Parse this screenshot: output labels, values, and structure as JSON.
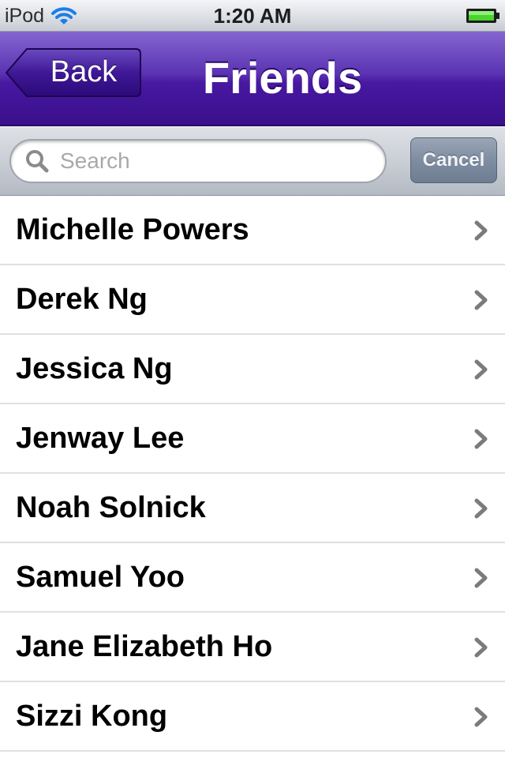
{
  "status_bar": {
    "carrier": "iPod",
    "time": "1:20 AM",
    "wifi_icon": "wifi-icon",
    "battery_icon": "battery-full-icon",
    "battery_color": "#4cd22d"
  },
  "nav_bar": {
    "back_label": "Back",
    "title": "Friends",
    "accent_color": "#4818a1"
  },
  "search": {
    "placeholder": "Search",
    "value": "",
    "cancel_label": "Cancel",
    "icon": "search-icon"
  },
  "friends": [
    {
      "name": "Michelle Powers"
    },
    {
      "name": "Derek Ng"
    },
    {
      "name": "Jessica Ng"
    },
    {
      "name": "Jenway Lee"
    },
    {
      "name": "Noah Solnick"
    },
    {
      "name": "Samuel Yoo"
    },
    {
      "name": "Jane Elizabeth Ho"
    },
    {
      "name": "Sizzi Kong"
    }
  ]
}
